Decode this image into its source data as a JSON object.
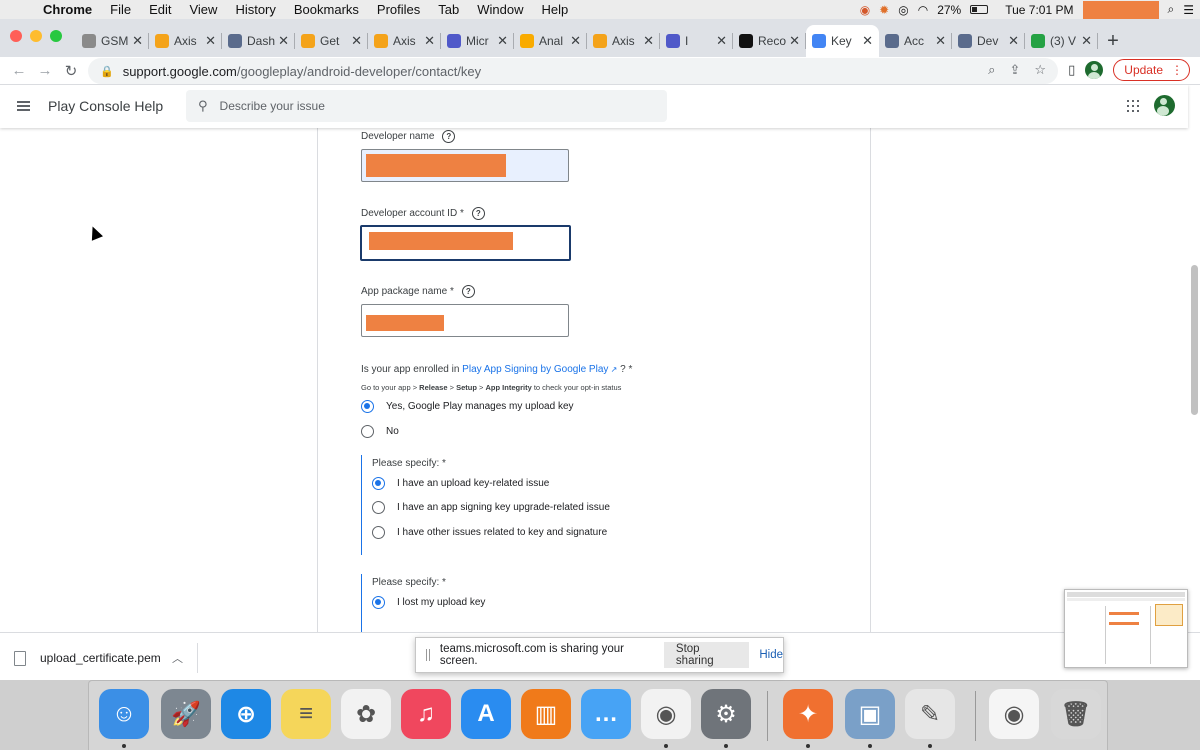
{
  "menubar": {
    "app": "Chrome",
    "items": [
      "File",
      "Edit",
      "View",
      "History",
      "Bookmarks",
      "Profiles",
      "Tab",
      "Window",
      "Help"
    ],
    "battery": "27%",
    "clock": "Tue 7:01 PM"
  },
  "tabs": [
    {
      "label": "GSM",
      "color": "#8a8a8a"
    },
    {
      "label": "Axis",
      "color": "#f4a31a"
    },
    {
      "label": "Dash",
      "color": "#5a6b8c"
    },
    {
      "label": "Get",
      "color": "#f4a31a"
    },
    {
      "label": "Axis",
      "color": "#f4a31a"
    },
    {
      "label": "Micr",
      "color": "#5059c9"
    },
    {
      "label": "Anal",
      "color": "#f9ab00"
    },
    {
      "label": "Axis",
      "color": "#f4a31a"
    },
    {
      "label": "I",
      "color": "#5059c9"
    },
    {
      "label": "Reco",
      "color": "#111111"
    },
    {
      "label": "Key",
      "color": "#4285f4",
      "active": true
    },
    {
      "label": "Acc",
      "color": "#5a6b8c"
    },
    {
      "label": "Dev",
      "color": "#5a6b8c"
    },
    {
      "label": "(3) V",
      "color": "#25a244"
    }
  ],
  "toolbar": {
    "url_host": "support.google.com",
    "url_path": "/googleplay/android-developer/contact/key",
    "update_label": "Update"
  },
  "help": {
    "title": "Play Console Help",
    "search_placeholder": "Describe your issue"
  },
  "form": {
    "developer_name_label": "Developer name",
    "developer_id_label": "Developer account ID *",
    "package_label": "App package name *",
    "q1_prefix": "Is your app enrolled in ",
    "q1_link": "Play App Signing by Google Play",
    "q1_suffix": " ?  *",
    "hint_prefix": "Go to your app > ",
    "hint_release": "Release",
    "hint_sep1": " > ",
    "hint_setup": "Setup",
    "hint_sep2": " > ",
    "hint_integrity": "App Integrity",
    "hint_suffix": " to check your opt-in status",
    "q1_options": [
      {
        "label": "Yes, Google Play manages my upload key",
        "checked": true
      },
      {
        "label": "No",
        "checked": false
      }
    ],
    "specify1_label": "Please specify: *",
    "specify1_options": [
      {
        "label": "I have an upload key-related issue",
        "checked": true
      },
      {
        "label": "I have an app signing key upgrade-related issue",
        "checked": false
      },
      {
        "label": "I have other issues related to key and signature",
        "checked": false
      }
    ],
    "specify2_label": "Please specify: *",
    "specify2_options": [
      {
        "label": "I lost my upload key",
        "checked": true
      }
    ]
  },
  "download": {
    "filename": "upload_certificate.pem"
  },
  "share_bar": {
    "message": "teams.microsoft.com is sharing your screen.",
    "stop_label": "Stop sharing",
    "hide_label": "Hide"
  },
  "dock": [
    {
      "name": "finder-icon",
      "color": "#3b8fe6",
      "glyph": "☺",
      "running": true
    },
    {
      "name": "launchpad-icon",
      "color": "#7d8791",
      "glyph": "🚀",
      "running": false
    },
    {
      "name": "safari-icon",
      "color": "#1e88e5",
      "glyph": "⊕",
      "running": false
    },
    {
      "name": "notes-icon",
      "color": "#f5d65a",
      "glyph": "≡",
      "running": false
    },
    {
      "name": "photos-icon",
      "color": "#f2f2f2",
      "glyph": "✿",
      "running": false
    },
    {
      "name": "music-icon",
      "color": "#f0475e",
      "glyph": "♫",
      "running": false
    },
    {
      "name": "app-store-icon",
      "color": "#2a8cf0",
      "glyph": "A",
      "running": false
    },
    {
      "name": "books-icon",
      "color": "#f07a1a",
      "glyph": "▥",
      "running": false
    },
    {
      "name": "messages-icon",
      "color": "#47a3f5",
      "glyph": "…",
      "running": false
    },
    {
      "name": "chrome-icon",
      "color": "#f2f2f2",
      "glyph": "◉",
      "running": true
    },
    {
      "name": "system-preferences-icon",
      "color": "#6f747a",
      "glyph": "⚙",
      "running": true
    },
    {
      "name": "sketchbook-icon",
      "color": "#f07030",
      "glyph": "✦",
      "running": true
    },
    {
      "name": "preview-icon",
      "color": "#7aa0c8",
      "glyph": "▣",
      "running": true
    },
    {
      "name": "textedit-icon",
      "color": "#e6e6e6",
      "glyph": "✎",
      "running": true
    },
    {
      "name": "chrome-window-thumb-icon",
      "color": "#f5f5f5",
      "glyph": "◉",
      "running": false
    },
    {
      "name": "trash-icon",
      "color": "#d8d8d8",
      "glyph": "🗑",
      "running": false
    }
  ]
}
